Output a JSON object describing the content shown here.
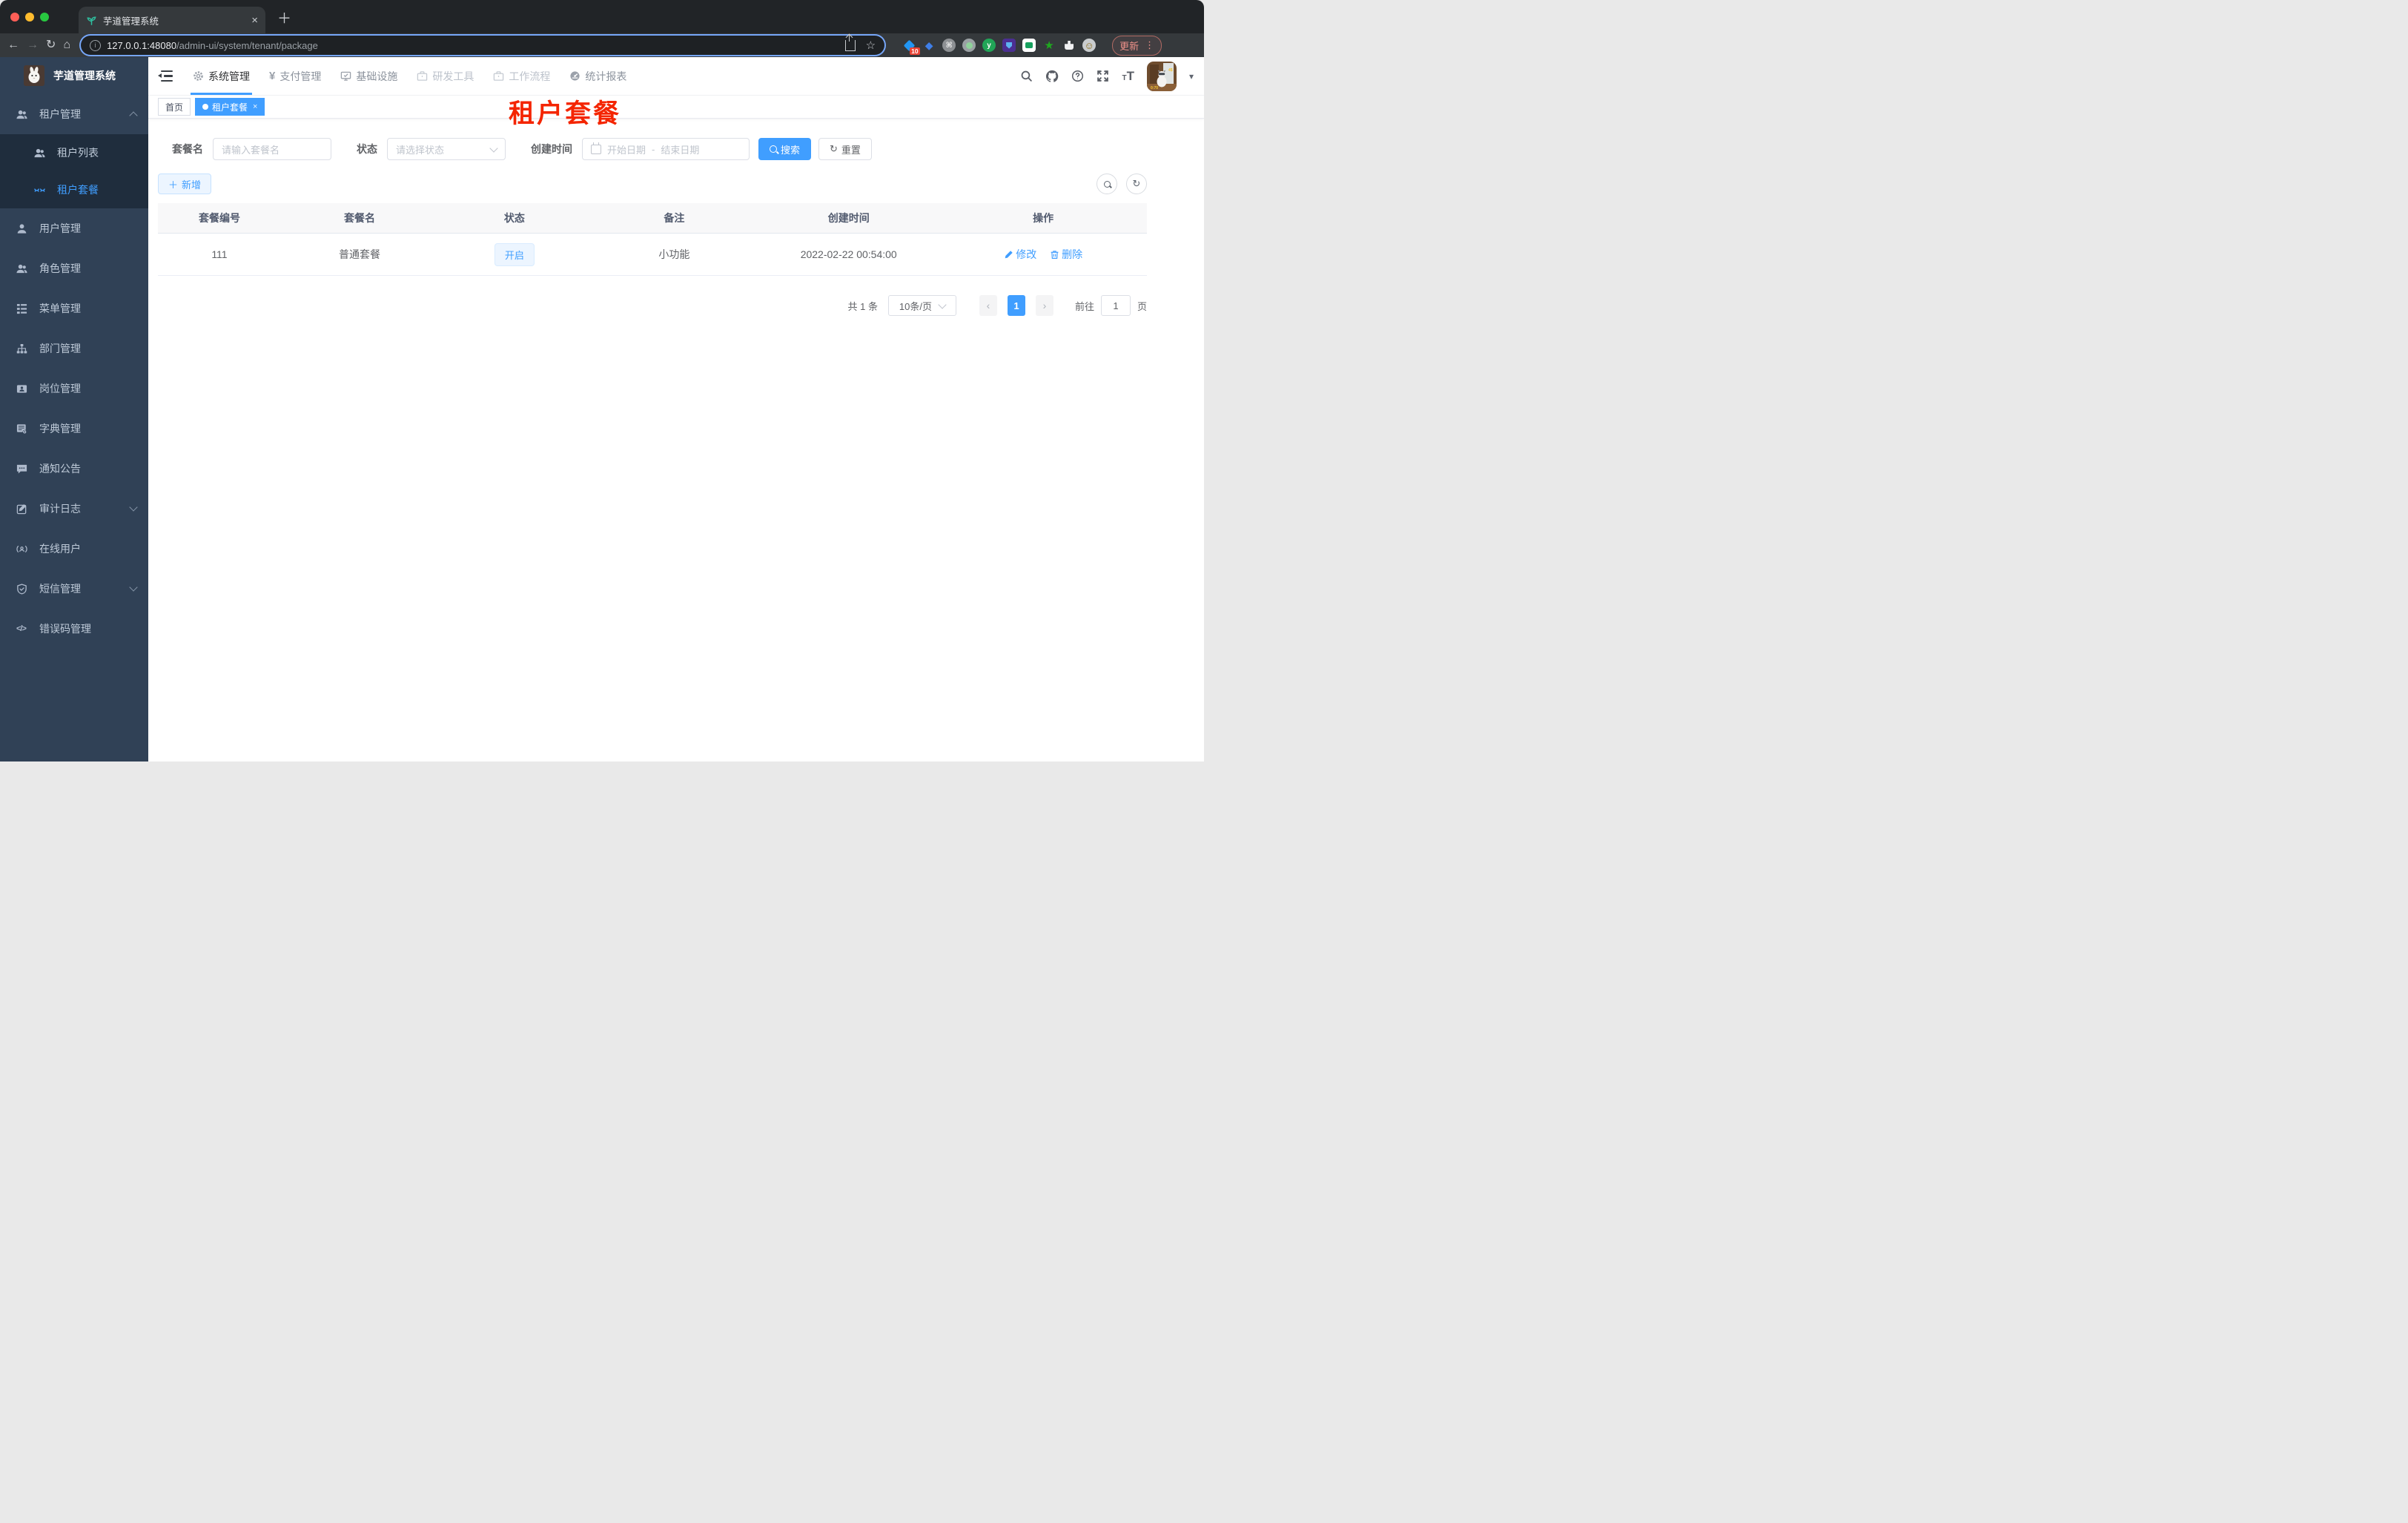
{
  "browser": {
    "tab": {
      "title": "芋道管理系统"
    },
    "url": {
      "host": "127.0.0.1:48080",
      "path": "/admin-ui/system/tenant/package"
    },
    "actions": {
      "update": "更新"
    },
    "extensions": {
      "badge": "10"
    }
  },
  "icons": {
    "close": "×",
    "plus": "＋",
    "back": "←",
    "forward": "→",
    "reload": "↻",
    "home": "⌂",
    "star": "☆",
    "overflow": "⋮",
    "caret_down": "▾",
    "prev": "‹",
    "next": "›",
    "yen": "¥",
    "question": "?",
    "font_small": "T",
    "font_large": "T",
    "code": "</>",
    "refresh": "↻",
    "info": "i",
    "cmd": "⌘",
    "smile": "☺",
    "ext_star": "★",
    "ext_y": "y"
  },
  "colors": {
    "primary": "#409EFF",
    "sidebar_bg": "#304156",
    "submenu_bg": "#1F2D3D",
    "annotation_red": "#F42500",
    "tag_active": "#409EFF"
  },
  "header": {
    "nav": [
      {
        "label": "系统管理"
      },
      {
        "label": "支付管理"
      },
      {
        "label": "基础设施"
      },
      {
        "label": "研发工具"
      },
      {
        "label": "工作流程"
      },
      {
        "label": "统计报表"
      }
    ]
  },
  "sidebar": {
    "title": "芋道管理系统",
    "items": [
      {
        "label": "租户管理",
        "icon": "users-icon"
      },
      {
        "label": "租户列表",
        "icon": "users-icon"
      },
      {
        "label": "租户套餐",
        "icon": "glasses-icon"
      },
      {
        "label": "用户管理",
        "icon": "user-icon"
      },
      {
        "label": "角色管理",
        "icon": "users-icon"
      },
      {
        "label": "菜单管理",
        "icon": "tree-icon"
      },
      {
        "label": "部门管理",
        "icon": "org-icon"
      },
      {
        "label": "岗位管理",
        "icon": "badge-icon"
      },
      {
        "label": "字典管理",
        "icon": "dict-icon"
      },
      {
        "label": "通知公告",
        "icon": "message-icon"
      },
      {
        "label": "审计日志",
        "icon": "log-icon"
      },
      {
        "label": "在线用户",
        "icon": "online-icon"
      },
      {
        "label": "短信管理",
        "icon": "shield-icon"
      },
      {
        "label": "错误码管理",
        "icon": "code-icon"
      }
    ]
  },
  "tags": {
    "items": [
      {
        "label": "首页"
      },
      {
        "label": "租户套餐"
      }
    ]
  },
  "annotation": {
    "text": "租户套餐"
  },
  "filters": {
    "name_label": "套餐名",
    "name_placeholder": "请输入套餐名",
    "status_label": "状态",
    "status_placeholder": "请选择状态",
    "date_label": "创建时间",
    "date_start": "开始日期",
    "date_sep": "-",
    "date_end": "结束日期",
    "search": "搜索",
    "reset": "重置"
  },
  "toolbar": {
    "add": "新增"
  },
  "table": {
    "columns": [
      "套餐编号",
      "套餐名",
      "状态",
      "备注",
      "创建时间",
      "操作"
    ],
    "row": {
      "id": "111",
      "name": "普通套餐",
      "status": "开启",
      "remark": "小功能",
      "created": "2022-02-22 00:54:00",
      "edit": "修改",
      "del": "删除"
    }
  },
  "pagination": {
    "total": "共 1 条",
    "page_size": "10条/页",
    "page": "1",
    "goto_label": "前往",
    "unit": "页",
    "goto_value": "1"
  }
}
